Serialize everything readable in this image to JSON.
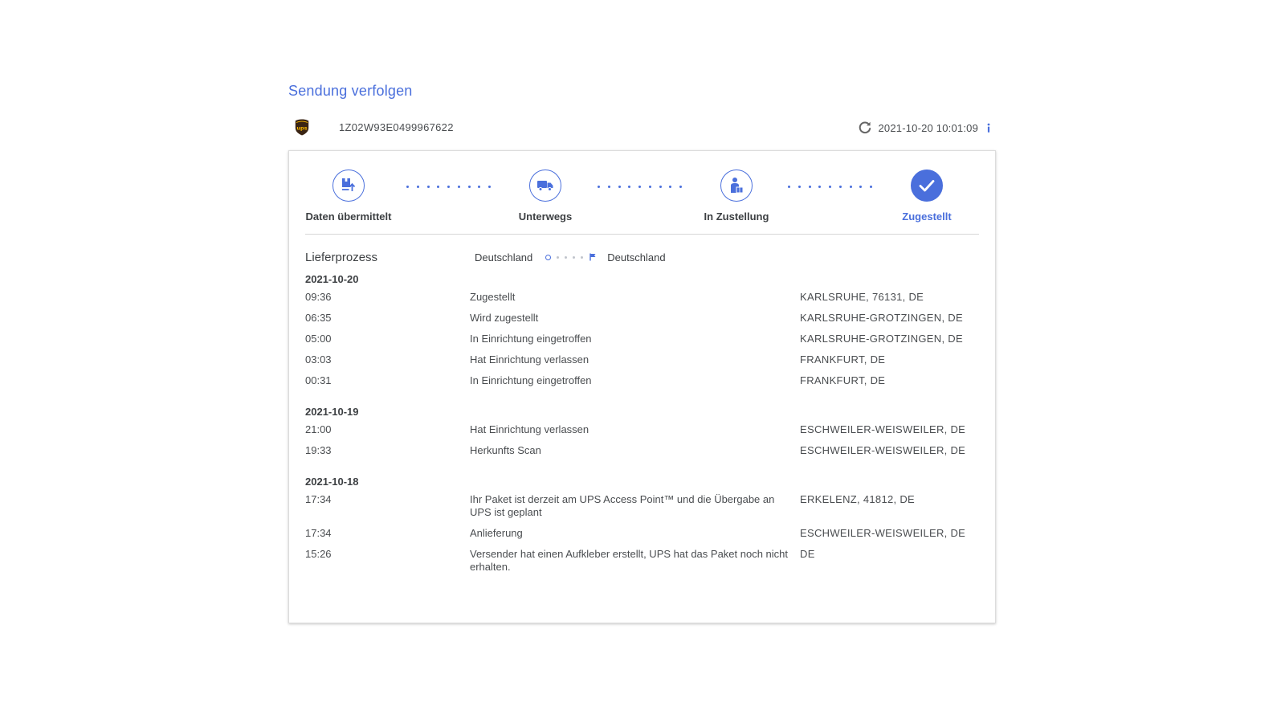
{
  "page": {
    "title": "Sendung verfolgen"
  },
  "header": {
    "carrier_icon": "ups-logo-icon",
    "tracking_number": "1Z02W93E0499967622",
    "refresh_icon": "refresh-icon",
    "last_updated": "2021-10-20 10:01:09",
    "info_icon": "info-icon"
  },
  "steps": [
    {
      "label": "Daten übermittelt",
      "icon": "package-upload-icon",
      "done": false
    },
    {
      "label": "Unterwegs",
      "icon": "truck-icon",
      "done": false
    },
    {
      "label": "In Zustellung",
      "icon": "courier-icon",
      "done": false
    },
    {
      "label": "Zugestellt",
      "icon": "checkmark-icon",
      "done": true
    }
  ],
  "process": {
    "title": "Lieferprozess",
    "origin": "Deutschland",
    "destination": "Deutschland"
  },
  "days": [
    {
      "date": "2021-10-20",
      "events": [
        {
          "time": "09:36",
          "description": "Zugestellt",
          "location": "KARLSRUHE, 76131, DE"
        },
        {
          "time": "06:35",
          "description": "Wird zugestellt",
          "location": "KARLSRUHE-GROTZINGEN, DE"
        },
        {
          "time": "05:00",
          "description": "In Einrichtung eingetroffen",
          "location": "KARLSRUHE-GROTZINGEN, DE"
        },
        {
          "time": "03:03",
          "description": "Hat Einrichtung verlassen",
          "location": "FRANKFURT, DE"
        },
        {
          "time": "00:31",
          "description": "In Einrichtung eingetroffen",
          "location": "FRANKFURT, DE"
        }
      ]
    },
    {
      "date": "2021-10-19",
      "events": [
        {
          "time": "21:00",
          "description": "Hat Einrichtung verlassen",
          "location": "ESCHWEILER-WEISWEILER, DE"
        },
        {
          "time": "19:33",
          "description": "Herkunfts Scan",
          "location": "ESCHWEILER-WEISWEILER, DE"
        }
      ]
    },
    {
      "date": "2021-10-18",
      "events": [
        {
          "time": "17:34",
          "description": "Ihr Paket ist derzeit am UPS Access Point™ und die Übergabe an UPS ist geplant",
          "location": "ERKELENZ, 41812, DE"
        },
        {
          "time": "17:34",
          "description": "Anlieferung",
          "location": "ESCHWEILER-WEISWEILER, DE"
        },
        {
          "time": "15:26",
          "description": "Versender hat einen Aufkleber erstellt, UPS hat das Paket noch nicht erhalten.",
          "location": "DE"
        }
      ]
    }
  ],
  "colors": {
    "accent": "#4a6fdc",
    "ups_brown": "#3a2413",
    "ups_gold": "#f5b400"
  }
}
